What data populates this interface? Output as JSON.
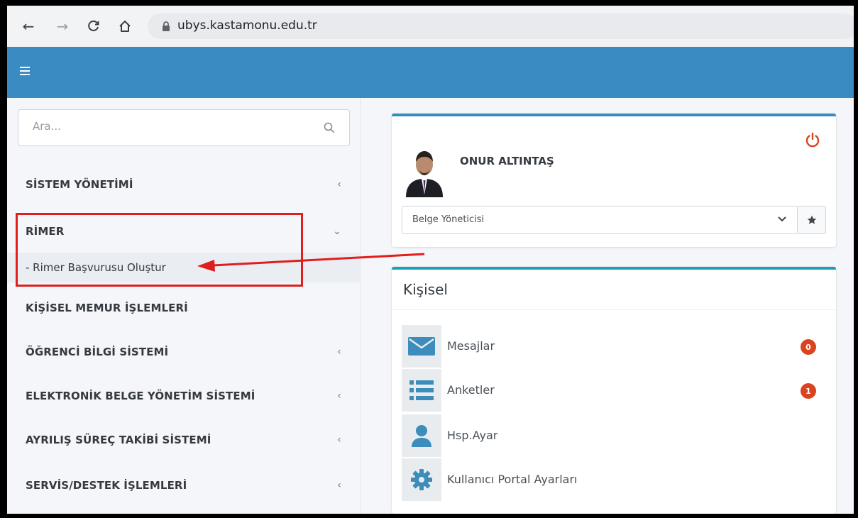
{
  "browser": {
    "url": "ubys.kastamonu.edu.tr"
  },
  "sidebar": {
    "search_placeholder": "Ara...",
    "items": [
      {
        "label": "SİSTEM YÖNETİMİ",
        "chevron": "‹"
      },
      {
        "label": "RİMER",
        "chevron": "⌄"
      },
      {
        "label": "KİŞİSEL MEMUR İŞLEMLERİ",
        "chevron": ""
      },
      {
        "label": "ÖĞRENCİ BİLGİ SİSTEMİ",
        "chevron": "‹"
      },
      {
        "label": "ELEKTRONİK BELGE YÖNETİM SİSTEMİ",
        "chevron": "‹"
      },
      {
        "label": "AYRILIŞ SÜREÇ TAKİBİ SİSTEMİ",
        "chevron": "‹"
      },
      {
        "label": "SERVİS/DESTEK İŞLEMLERİ",
        "chevron": "‹"
      }
    ],
    "submenu": {
      "label": "- Rimer Başvurusu Oluştur"
    }
  },
  "user_card": {
    "name": "ONUR ALTINTAŞ",
    "role_selected": "Belge Yöneticisi"
  },
  "personal_card": {
    "title": "Kişisel",
    "rows": [
      {
        "label": "Mesajlar",
        "icon": "envelope-icon",
        "badge": "0"
      },
      {
        "label": "Anketler",
        "icon": "list-icon",
        "badge": "1"
      },
      {
        "label": "Hsp.Ayar",
        "icon": "user-icon",
        "badge": ""
      },
      {
        "label": "Kullanıcı Portal Ayarları",
        "icon": "gear-icon",
        "badge": ""
      }
    ]
  },
  "colors": {
    "header_blue": "#3a8bc2",
    "accent_teal": "#17a2b8",
    "badge_red": "#d9441f",
    "annotation_red": "#e01e1e",
    "icon_blue": "#3c8dbc"
  }
}
